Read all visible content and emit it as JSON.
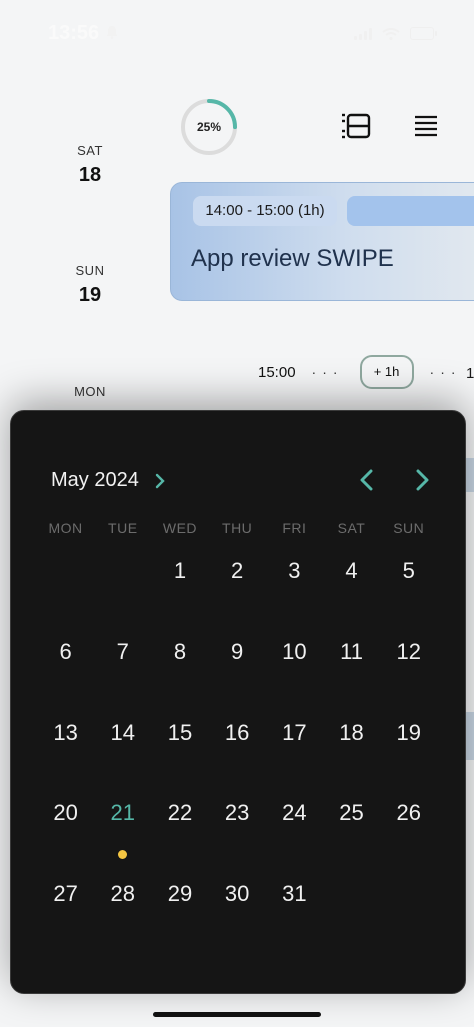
{
  "status_bar": {
    "time": "13:56"
  },
  "header": {
    "progress_label": "25%",
    "progress_value": 0.25
  },
  "days": [
    {
      "name": "SAT",
      "num": "18"
    },
    {
      "name": "SUN",
      "num": "19"
    },
    {
      "name": "MON",
      "num": ""
    }
  ],
  "event": {
    "time": "14:00 - 15:00 (1h)",
    "title": "App review SWIPE"
  },
  "gap": {
    "time": "15:00",
    "pill": "+ 1h",
    "edge": "1"
  },
  "calendar": {
    "month_label": "May 2024",
    "weekdays": [
      "MON",
      "TUE",
      "WED",
      "THU",
      "FRI",
      "SAT",
      "SUN"
    ],
    "leading_blanks": 2,
    "days": [
      "1",
      "2",
      "3",
      "4",
      "5",
      "6",
      "7",
      "8",
      "9",
      "10",
      "11",
      "12",
      "13",
      "14",
      "15",
      "16",
      "17",
      "18",
      "19",
      "20",
      "21",
      "22",
      "23",
      "24",
      "25",
      "26",
      "27",
      "28",
      "29",
      "30",
      "31"
    ],
    "today": "21",
    "accent_color": "#56b7a8",
    "dot_color": "#f4c542"
  }
}
